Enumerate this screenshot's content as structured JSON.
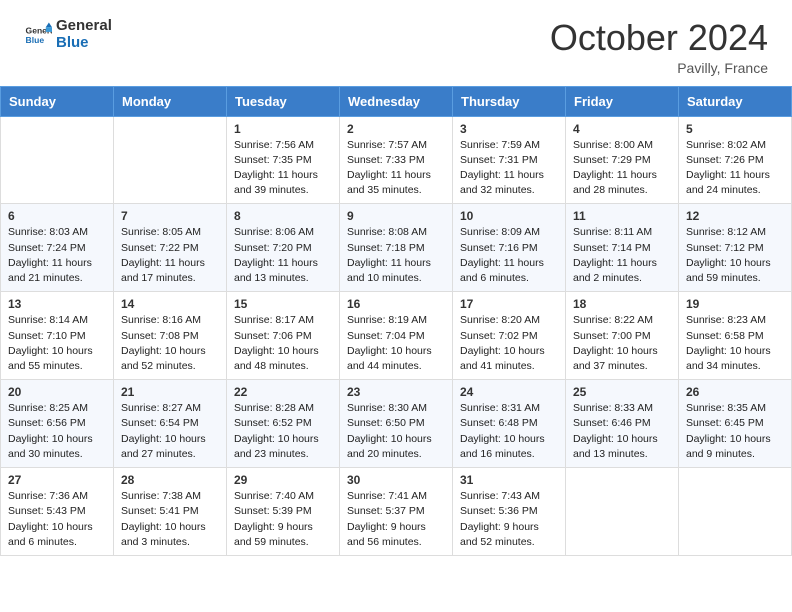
{
  "header": {
    "logo_line1": "General",
    "logo_line2": "Blue",
    "month_title": "October 2024",
    "location": "Pavilly, France"
  },
  "days_of_week": [
    "Sunday",
    "Monday",
    "Tuesday",
    "Wednesday",
    "Thursday",
    "Friday",
    "Saturday"
  ],
  "weeks": [
    [
      {
        "day": "",
        "info": ""
      },
      {
        "day": "",
        "info": ""
      },
      {
        "day": "1",
        "info": "Sunrise: 7:56 AM\nSunset: 7:35 PM\nDaylight: 11 hours and 39 minutes."
      },
      {
        "day": "2",
        "info": "Sunrise: 7:57 AM\nSunset: 7:33 PM\nDaylight: 11 hours and 35 minutes."
      },
      {
        "day": "3",
        "info": "Sunrise: 7:59 AM\nSunset: 7:31 PM\nDaylight: 11 hours and 32 minutes."
      },
      {
        "day": "4",
        "info": "Sunrise: 8:00 AM\nSunset: 7:29 PM\nDaylight: 11 hours and 28 minutes."
      },
      {
        "day": "5",
        "info": "Sunrise: 8:02 AM\nSunset: 7:26 PM\nDaylight: 11 hours and 24 minutes."
      }
    ],
    [
      {
        "day": "6",
        "info": "Sunrise: 8:03 AM\nSunset: 7:24 PM\nDaylight: 11 hours and 21 minutes."
      },
      {
        "day": "7",
        "info": "Sunrise: 8:05 AM\nSunset: 7:22 PM\nDaylight: 11 hours and 17 minutes."
      },
      {
        "day": "8",
        "info": "Sunrise: 8:06 AM\nSunset: 7:20 PM\nDaylight: 11 hours and 13 minutes."
      },
      {
        "day": "9",
        "info": "Sunrise: 8:08 AM\nSunset: 7:18 PM\nDaylight: 11 hours and 10 minutes."
      },
      {
        "day": "10",
        "info": "Sunrise: 8:09 AM\nSunset: 7:16 PM\nDaylight: 11 hours and 6 minutes."
      },
      {
        "day": "11",
        "info": "Sunrise: 8:11 AM\nSunset: 7:14 PM\nDaylight: 11 hours and 2 minutes."
      },
      {
        "day": "12",
        "info": "Sunrise: 8:12 AM\nSunset: 7:12 PM\nDaylight: 10 hours and 59 minutes."
      }
    ],
    [
      {
        "day": "13",
        "info": "Sunrise: 8:14 AM\nSunset: 7:10 PM\nDaylight: 10 hours and 55 minutes."
      },
      {
        "day": "14",
        "info": "Sunrise: 8:16 AM\nSunset: 7:08 PM\nDaylight: 10 hours and 52 minutes."
      },
      {
        "day": "15",
        "info": "Sunrise: 8:17 AM\nSunset: 7:06 PM\nDaylight: 10 hours and 48 minutes."
      },
      {
        "day": "16",
        "info": "Sunrise: 8:19 AM\nSunset: 7:04 PM\nDaylight: 10 hours and 44 minutes."
      },
      {
        "day": "17",
        "info": "Sunrise: 8:20 AM\nSunset: 7:02 PM\nDaylight: 10 hours and 41 minutes."
      },
      {
        "day": "18",
        "info": "Sunrise: 8:22 AM\nSunset: 7:00 PM\nDaylight: 10 hours and 37 minutes."
      },
      {
        "day": "19",
        "info": "Sunrise: 8:23 AM\nSunset: 6:58 PM\nDaylight: 10 hours and 34 minutes."
      }
    ],
    [
      {
        "day": "20",
        "info": "Sunrise: 8:25 AM\nSunset: 6:56 PM\nDaylight: 10 hours and 30 minutes."
      },
      {
        "day": "21",
        "info": "Sunrise: 8:27 AM\nSunset: 6:54 PM\nDaylight: 10 hours and 27 minutes."
      },
      {
        "day": "22",
        "info": "Sunrise: 8:28 AM\nSunset: 6:52 PM\nDaylight: 10 hours and 23 minutes."
      },
      {
        "day": "23",
        "info": "Sunrise: 8:30 AM\nSunset: 6:50 PM\nDaylight: 10 hours and 20 minutes."
      },
      {
        "day": "24",
        "info": "Sunrise: 8:31 AM\nSunset: 6:48 PM\nDaylight: 10 hours and 16 minutes."
      },
      {
        "day": "25",
        "info": "Sunrise: 8:33 AM\nSunset: 6:46 PM\nDaylight: 10 hours and 13 minutes."
      },
      {
        "day": "26",
        "info": "Sunrise: 8:35 AM\nSunset: 6:45 PM\nDaylight: 10 hours and 9 minutes."
      }
    ],
    [
      {
        "day": "27",
        "info": "Sunrise: 7:36 AM\nSunset: 5:43 PM\nDaylight: 10 hours and 6 minutes."
      },
      {
        "day": "28",
        "info": "Sunrise: 7:38 AM\nSunset: 5:41 PM\nDaylight: 10 hours and 3 minutes."
      },
      {
        "day": "29",
        "info": "Sunrise: 7:40 AM\nSunset: 5:39 PM\nDaylight: 9 hours and 59 minutes."
      },
      {
        "day": "30",
        "info": "Sunrise: 7:41 AM\nSunset: 5:37 PM\nDaylight: 9 hours and 56 minutes."
      },
      {
        "day": "31",
        "info": "Sunrise: 7:43 AM\nSunset: 5:36 PM\nDaylight: 9 hours and 52 minutes."
      },
      {
        "day": "",
        "info": ""
      },
      {
        "day": "",
        "info": ""
      }
    ]
  ]
}
